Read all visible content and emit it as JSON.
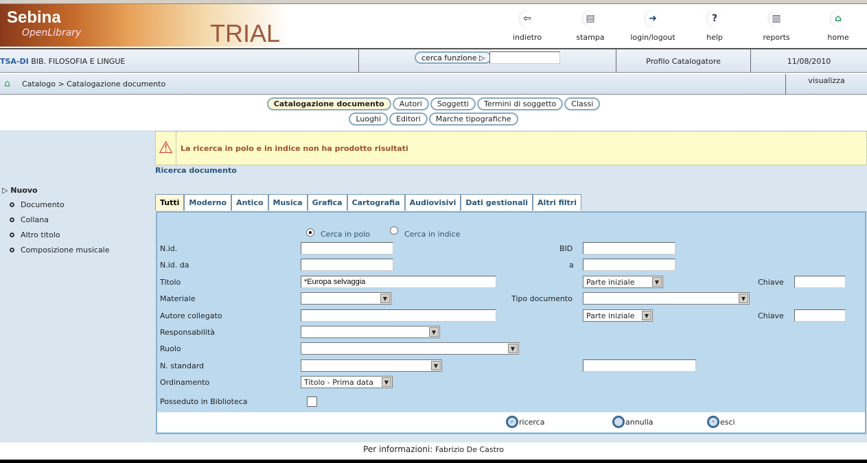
{
  "header": {
    "logo_brand": "Sebina",
    "logo_sub": "OpenLibrary",
    "logo_trial": "TRIAL",
    "tools": [
      {
        "label": "indietro",
        "icon": "back-arrow-icon"
      },
      {
        "label": "stampa",
        "icon": "printer-icon"
      },
      {
        "label": "login/logout",
        "icon": "door-icon"
      },
      {
        "label": "help",
        "icon": "help-icon"
      },
      {
        "label": "reports",
        "icon": "reports-icon"
      },
      {
        "label": "home",
        "icon": "home-icon"
      }
    ]
  },
  "infobar": {
    "library_code": "TSA-DI",
    "library_name": "BIB. FILOSOFIA E LINGUE",
    "search_function_label": "cerca funzione",
    "search_function_value": "",
    "profile": "Profilo Catalogatore",
    "date": "11/08/2010"
  },
  "breadcrumb": {
    "items": "Catalogo > Catalogazione documento",
    "visualizza": "visualizza"
  },
  "nav": {
    "row1": [
      "Catalogazione documento",
      "Autori",
      "Soggetti",
      "Termini di soggetto",
      "Classi"
    ],
    "row2": [
      "Luoghi",
      "Editori",
      "Marche tipografiche"
    ]
  },
  "warning": "La ricerca in polo e in indice non ha prodotto risultati",
  "section_title": "Ricerca documento",
  "sidebar": {
    "title": "Nuovo",
    "items": [
      "Documento",
      "Collana",
      "Altro titolo",
      "Composizione musicale"
    ]
  },
  "tabs": [
    "Tutti",
    "Moderno",
    "Antico",
    "Musica",
    "Grafica",
    "Cartografia",
    "Audiovisivi",
    "Dati gestionali",
    "Altri filtri"
  ],
  "form": {
    "radio_polo": "Cerca in polo",
    "radio_indice": "Cerca in indice",
    "radio_selected": "Cerca in polo",
    "nid": "N.id.",
    "nid_da": "N.id. da",
    "bid": "BID",
    "a": "a",
    "titolo": "Titolo",
    "titolo_value": "*Europa selvaggia",
    "titolo_mode": "Parte iniziale",
    "chiave": "Chiave",
    "materiale": "Materiale",
    "tipo_documento": "Tipo documento",
    "autore": "Autore collegato",
    "autore_mode": "Parte iniziale",
    "chiave2": "Chiave",
    "responsabilita": "Responsabilità",
    "ruolo": "Ruolo",
    "n_standard": "N. standard",
    "ordinamento": "Ordinamento",
    "ordinamento_value": "Titolo - Prima data",
    "posseduto": "Posseduto in Biblioteca",
    "posseduto_checked": false
  },
  "actions": {
    "ricerca": "ricerca",
    "annulla": "annulla",
    "esci": "esci"
  },
  "footer": {
    "label": "Per informazioni:",
    "name": "Fabrizio De Castro"
  }
}
